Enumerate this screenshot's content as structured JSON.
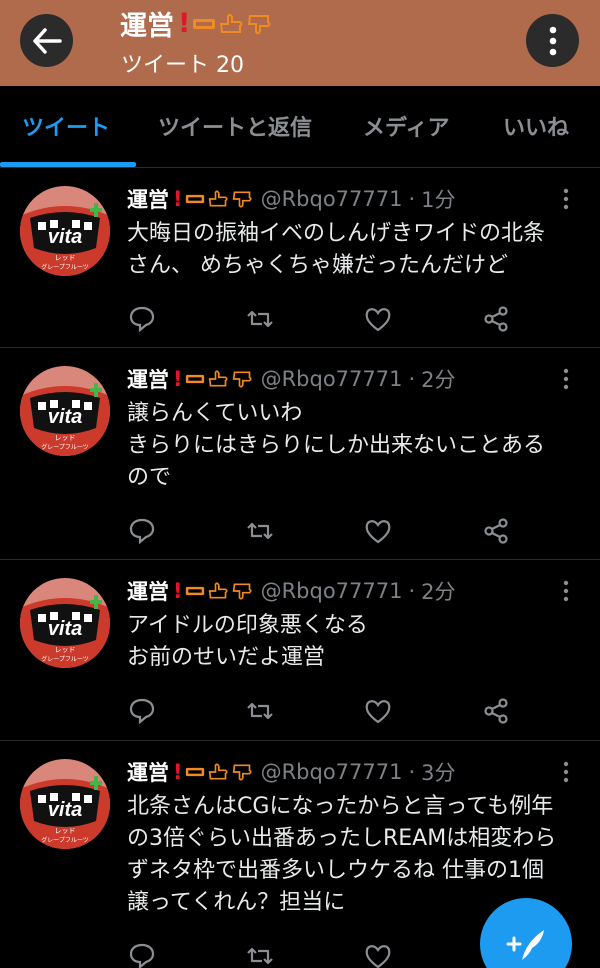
{
  "header": {
    "title": "運営",
    "title_emoji": "❗🈚👍👎",
    "subtitle": "ツイート 20",
    "back_icon": "arrow-left-icon",
    "menu_icon": "more-vertical-icon",
    "background_color": "#b06a4c"
  },
  "tabs": [
    {
      "label": "ツイート",
      "active": true
    },
    {
      "label": "ツイートと返信",
      "active": false
    },
    {
      "label": "メディア",
      "active": false
    },
    {
      "label": "いいね",
      "active": false
    }
  ],
  "accent_color": "#1d9bf0",
  "tweets": [
    {
      "name": "運営",
      "handle": "@Rbqo77771",
      "time": "1分",
      "lines": [
        "大晦日の振袖イベのしんげきワイドの北条",
        "さん、 めちゃくちゃ嫌だったんだけど"
      ]
    },
    {
      "name": "運営",
      "handle": "@Rbqo77771",
      "time": "2分",
      "lines": [
        "譲らんくていいわ",
        "きらりにはきらりにしか出来ないことある",
        "ので"
      ]
    },
    {
      "name": "運営",
      "handle": "@Rbqo77771",
      "time": "2分",
      "lines": [
        "アイドルの印象悪くなる",
        "お前のせいだよ運営"
      ]
    },
    {
      "name": "運営",
      "handle": "@Rbqo77771",
      "time": "3分",
      "lines": [
        "北条さんはCGになったからと言っても例年",
        "の3倍ぐらい出番あったしREAMは相変わら",
        "ずネタ枠で出番多いしウケるね 仕事の1個",
        "譲ってくれん？担当に"
      ]
    }
  ],
  "avatar_text": "vita",
  "avatar_subtext": "レッド グレープフルーツ",
  "action_icons": [
    "reply-icon",
    "retweet-icon",
    "like-icon",
    "share-icon"
  ],
  "fab_icon": "compose-tweet-icon"
}
